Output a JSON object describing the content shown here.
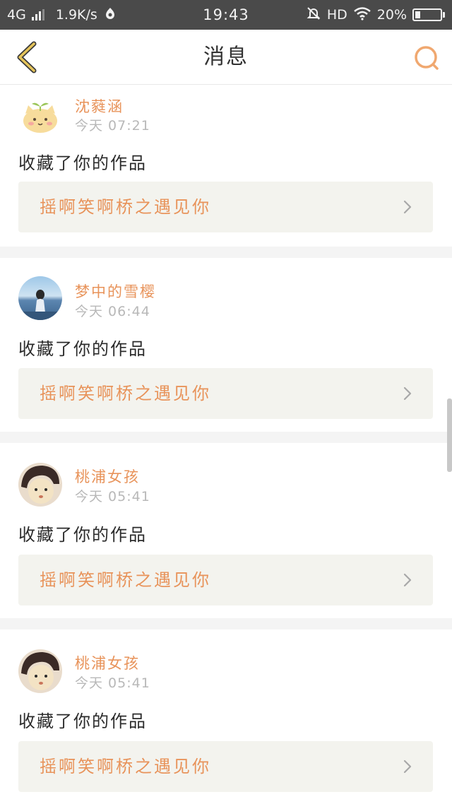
{
  "status_bar": {
    "network": "4G",
    "speed": "1.9K/s",
    "time": "19:43",
    "hd": "HD",
    "battery_text": "20%",
    "battery_level": 0.2,
    "icons": [
      "signal-icon",
      "app-notify-icon",
      "mute-bell-icon",
      "wifi-icon",
      "battery-icon"
    ]
  },
  "nav": {
    "back_icon": "chevron-left-icon",
    "title": "消息",
    "search_icon": "search-icon",
    "accent_color": "#f0a870",
    "back_color": "#d8b85a"
  },
  "messages": [
    {
      "user": "沈蕤涵",
      "time": "今天 07:21",
      "action": "收藏了你的作品",
      "work": "摇啊笑啊桥之遇见你",
      "avatar": "cat-avatar-icon"
    },
    {
      "user": "梦中的雪樱",
      "time": "今天 06:44",
      "action": "收藏了你的作品",
      "work": "摇啊笑啊桥之遇见你",
      "avatar": "girl-sea-avatar"
    },
    {
      "user": "桃浦女孩",
      "time": "今天 05:41",
      "action": "收藏了你的作品",
      "work": "摇啊笑啊桥之遇见你",
      "avatar": "girl-face-avatar"
    },
    {
      "user": "桃浦女孩",
      "time": "今天 05:41",
      "action": "收藏了你的作品",
      "work": "摇啊笑啊桥之遇见你",
      "avatar": "girl-face-avatar"
    }
  ]
}
